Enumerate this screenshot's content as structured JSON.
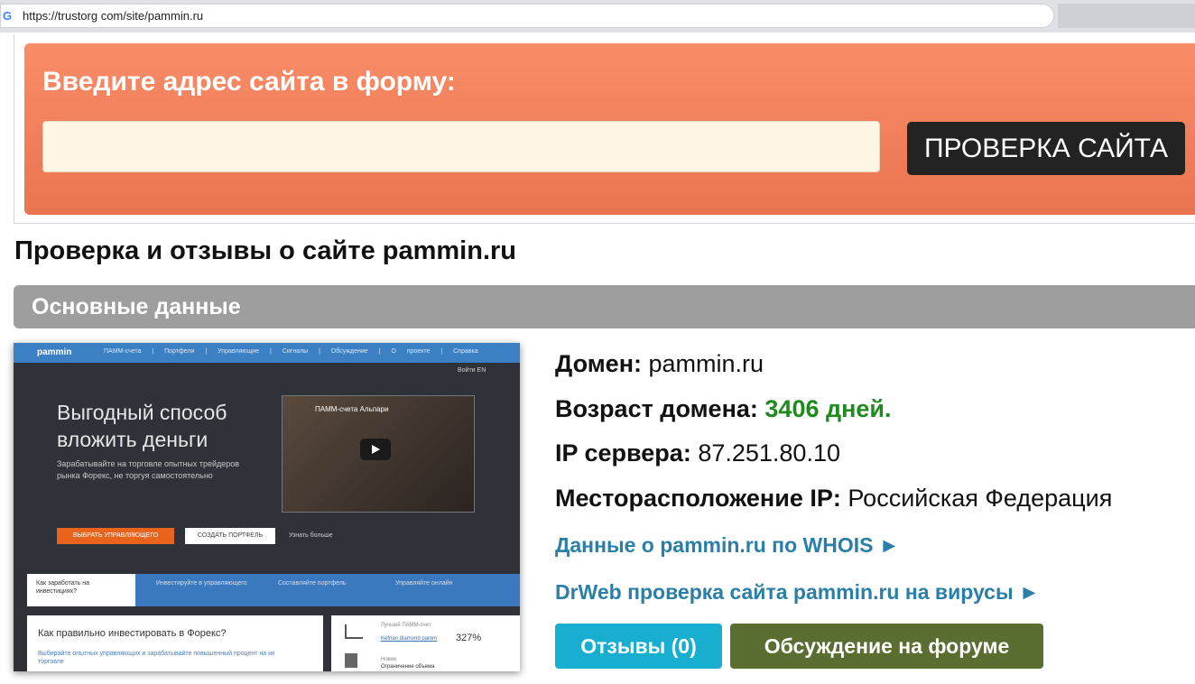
{
  "browser": {
    "url": "https://trustorg com/site/pammin.ru",
    "favicon": "google-g-icon"
  },
  "check_form": {
    "label": "Введите адрес сайта в форму:",
    "input_value": "",
    "button_label": "ПРОВЕРКА САЙТА"
  },
  "page": {
    "title": "Проверка и отзывы о сайте pammin.ru",
    "section_title": "Основные данные"
  },
  "thumbnail": {
    "logo": "pammin",
    "menu": "ПАММ-счета | Портфели | Управляющие | Сигналы | Обсуждение | О проекте | Справка",
    "login": "Войти  EN",
    "headline_1": "Выгодный способ",
    "headline_2": "вложить деньги",
    "subtext": "Зарабатывайте на торговле опытных трейдеров рынка Форекс, не торгуя самостоятельно",
    "video_title": "ПАММ-счета Альпари",
    "btn_primary": "ВЫБРАТЬ УПРАВЛЯЮЩЕГО",
    "btn_secondary": "СОЗДАТЬ ПОРТФЕЛЬ",
    "more": "Узнать больше",
    "tabs": [
      "Как заработать на инвестициях?",
      "Инвестируйте в управляющего",
      "Составляйте портфель",
      "Управляйте онлайн"
    ],
    "card_title": "Как правильно инвестировать в Форекс?",
    "card_text": "Выбирайте опытных управляющих и зарабатывайте повышенный процент на их торговле",
    "side_label": "Лучший ПАММ-счет",
    "side_link": "Kefrian diamond pamm",
    "side_pct": "327%",
    "side_label2": "Новое",
    "side_text2": "Ограничение объема"
  },
  "info": {
    "domain_label": "Домен:",
    "domain_value": "pammin.ru",
    "age_label": "Возраст домена:",
    "age_value": "3406 дней.",
    "ip_label": "IP сервера:",
    "ip_value": "87.251.80.10",
    "location_label": "Месторасположение IP:",
    "location_value": "Российская Федерация",
    "whois_link": "Данные о pammin.ru по WHOIS ►",
    "drweb_link": "DrWeb проверка сайта pammin.ru на вирусы ►",
    "reviews_button": "Отзывы (0)",
    "forum_button": "Обсуждение на форуме"
  },
  "colors": {
    "form_panel": "#f2805c",
    "section_header": "#9e9e9e",
    "age_green": "#1e8b1e",
    "link_blue": "#2a7fa8",
    "reviews_btn": "#17aed0",
    "forum_btn": "#5a6e32"
  }
}
